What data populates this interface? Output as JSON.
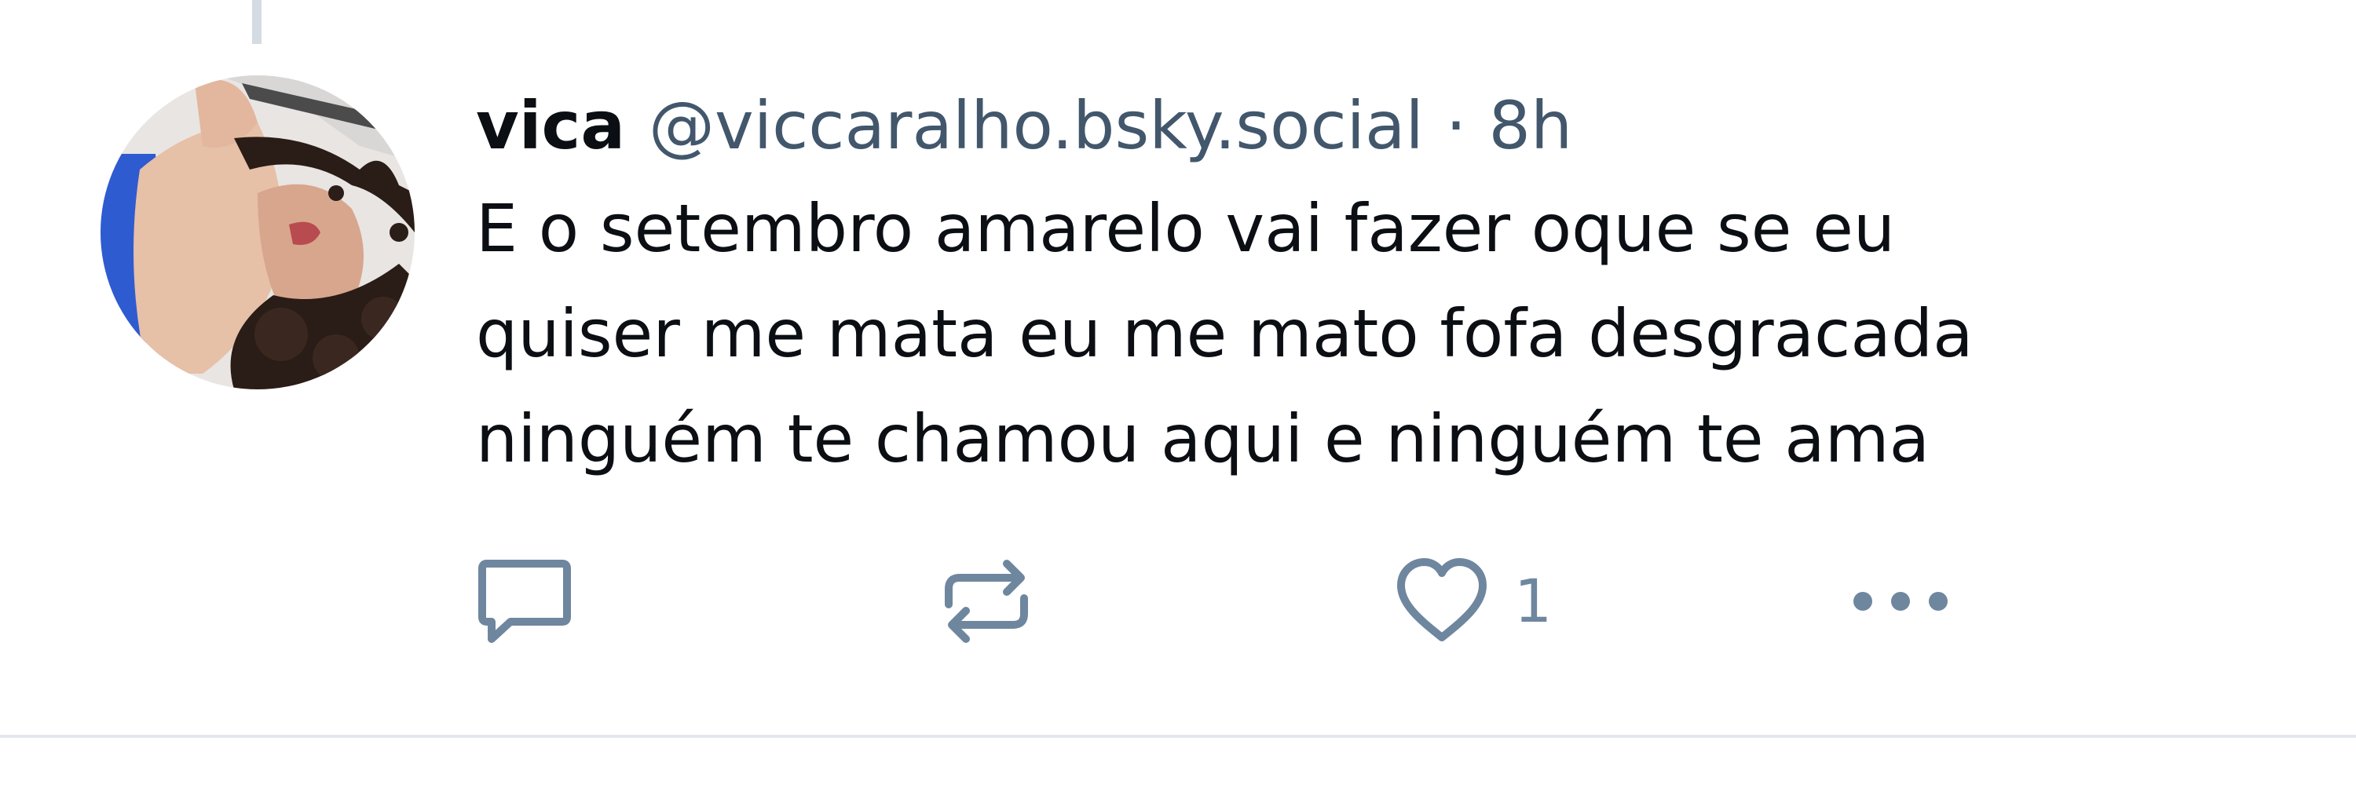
{
  "post": {
    "author": {
      "display_name": "vica",
      "handle": "@viccaralho.bsky.social"
    },
    "separator": "·",
    "timestamp": "8h",
    "text_lines": [
      "E o setembro amarelo vai fazer oque se eu",
      "quiser me mata eu me mato fofa desgracada",
      "ninguém te chamou aqui e ninguém te ama"
    ],
    "actions": {
      "reply_icon": "speech-bubble-icon",
      "repost_icon": "repost-arrows-icon",
      "like_icon": "heart-outline-icon",
      "like_count": "1",
      "more_icon": "ellipsis-icon"
    }
  },
  "colors": {
    "text_primary": "#0b0f14",
    "text_secondary": "#42576c",
    "icon": "#6f869f",
    "thread_line": "#d4dbe2",
    "divider": "#e4e8ec"
  }
}
